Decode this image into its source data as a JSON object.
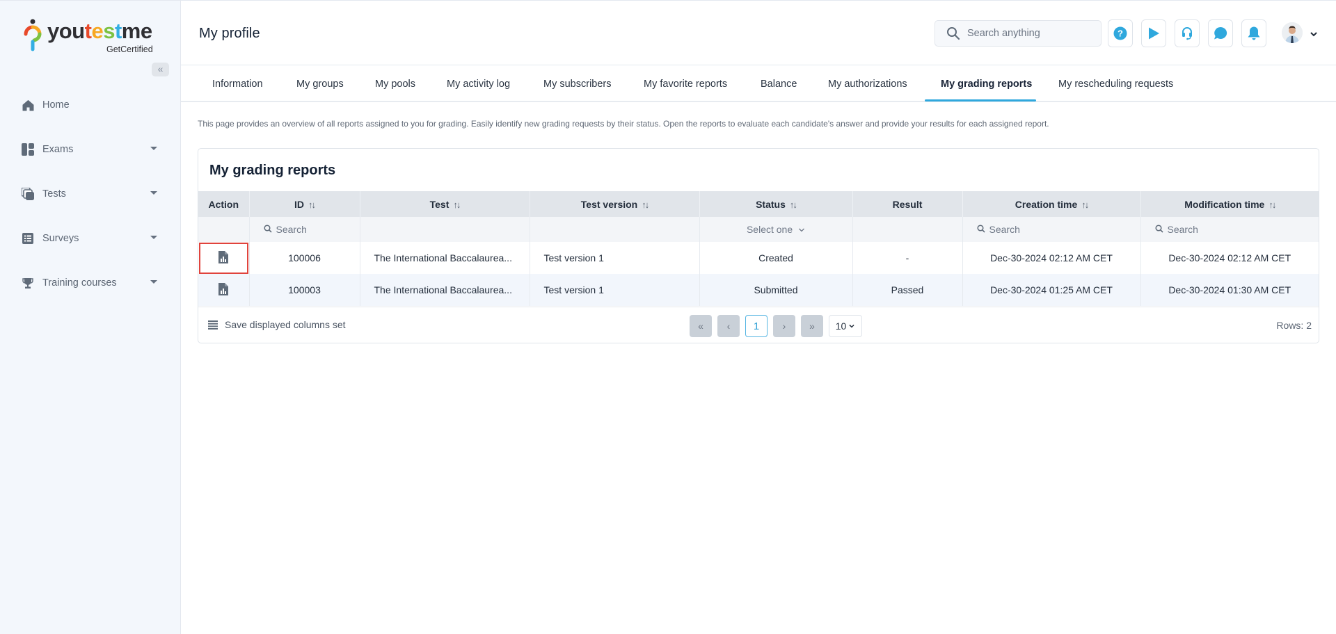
{
  "brand": {
    "name_parts": [
      "you",
      "t",
      "e",
      "s",
      "t",
      "me"
    ],
    "tagline": "GetCertified"
  },
  "sidebar": {
    "collapse_icon": "double-chevron-left-icon",
    "items": [
      {
        "label": "Home",
        "icon": "home-icon",
        "has_submenu": false
      },
      {
        "label": "Exams",
        "icon": "dashboard-icon",
        "has_submenu": true
      },
      {
        "label": "Tests",
        "icon": "stacked-pages-icon",
        "has_submenu": true
      },
      {
        "label": "Surveys",
        "icon": "list-icon",
        "has_submenu": true
      },
      {
        "label": "Training courses",
        "icon": "trophy-icon",
        "has_submenu": true
      }
    ]
  },
  "header": {
    "title": "My profile",
    "search_placeholder": "Search anything",
    "buttons": [
      "help-icon",
      "play-icon",
      "headset-icon",
      "chat-icon",
      "bell-icon"
    ],
    "accent_color": "#2fa8dd"
  },
  "tabs": {
    "items": [
      {
        "label": "Information",
        "active": false
      },
      {
        "label": "My groups",
        "active": false
      },
      {
        "label": "My pools",
        "active": false
      },
      {
        "label": "My activity log",
        "active": false
      },
      {
        "label": "My subscribers",
        "active": false
      },
      {
        "label": "My favorite reports",
        "active": false
      },
      {
        "label": "Balance",
        "active": false
      },
      {
        "label": "My authorizations",
        "active": false
      },
      {
        "label": "My grading reports",
        "active": true
      },
      {
        "label": "My rescheduling requests",
        "active": false
      }
    ]
  },
  "description": "This page provides an overview of all reports assigned to you for grading. Easily identify new grading requests by their status. Open the reports to evaluate each candidate's answer and provide your results for each assigned report.",
  "grid": {
    "title": "My grading reports",
    "columns": [
      {
        "label": "Action",
        "sortable": false
      },
      {
        "label": "ID",
        "sortable": true
      },
      {
        "label": "Test",
        "sortable": true
      },
      {
        "label": "Test version",
        "sortable": true
      },
      {
        "label": "Status",
        "sortable": true
      },
      {
        "label": "Result",
        "sortable": false
      },
      {
        "label": "Creation time",
        "sortable": true
      },
      {
        "label": "Modification time",
        "sortable": true
      }
    ],
    "sort_glyph": "↑↓",
    "filters": {
      "id_placeholder": "Search",
      "status_select": "Select one",
      "creation_placeholder": "Search",
      "modification_placeholder": "Search"
    },
    "rows": [
      {
        "action_icon": "report-icon",
        "id": "100006",
        "test": "The International Baccalaurea...",
        "version": "Test version 1",
        "status": "Created",
        "result": "-",
        "created": "Dec-30-2024 02:12 AM CET",
        "modified": "Dec-30-2024 02:12 AM CET",
        "highlighted": true
      },
      {
        "action_icon": "report-icon",
        "id": "100003",
        "test": "The International Baccalaurea...",
        "version": "Test version 1",
        "status": "Submitted",
        "result": "Passed",
        "created": "Dec-30-2024 01:25 AM CET",
        "modified": "Dec-30-2024 01:30 AM CET",
        "highlighted": false
      }
    ],
    "footer": {
      "save_columns_label": "Save displayed columns set",
      "first_label": "«",
      "prev_label": "‹",
      "current_page": "1",
      "next_label": "›",
      "last_label": "»",
      "page_size": "10",
      "rows_label": "Rows: 2"
    }
  }
}
